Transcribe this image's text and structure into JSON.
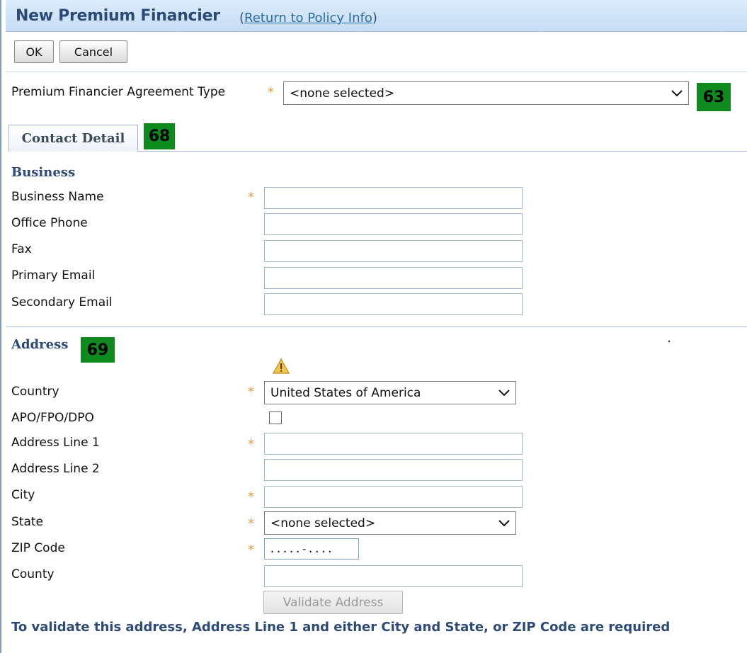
{
  "header": {
    "title": "New Premium Financier",
    "paren_open": "(",
    "link_text": "Return to Policy Info",
    "paren_close": ")"
  },
  "toolbar": {
    "ok_label": "OK",
    "cancel_label": "Cancel"
  },
  "agreement": {
    "label": "Premium Financier Agreement Type",
    "value": "<none selected>",
    "badge": "63"
  },
  "tab": {
    "label": "Contact Detail",
    "badge": "68"
  },
  "business": {
    "heading": "Business",
    "fields": [
      {
        "label": "Business Name",
        "required": true,
        "value": ""
      },
      {
        "label": "Office Phone",
        "required": false,
        "value": ""
      },
      {
        "label": "Fax",
        "required": false,
        "value": ""
      },
      {
        "label": "Primary Email",
        "required": false,
        "value": ""
      },
      {
        "label": "Secondary Email",
        "required": false,
        "value": ""
      }
    ]
  },
  "address": {
    "heading": "Address",
    "badge": "69",
    "country_label": "Country",
    "country_value": "United States of America",
    "apo_label": "APO/FPO/DPO",
    "line1_label": "Address Line 1",
    "line2_label": "Address Line 2",
    "city_label": "City",
    "state_label": "State",
    "state_value": "<none selected>",
    "zip_label": "ZIP Code",
    "zip_value": ".....-....",
    "county_label": "County",
    "validate_label": "Validate Address",
    "message": "To validate this address, Address Line 1 and either City and State, or ZIP Code are required"
  },
  "required_mark": "*",
  "colors": {
    "accent": "#2b4a78",
    "required": "#e39a3b",
    "badge": "#0f8a1f",
    "warning": "#f2c94c"
  },
  "icons": {
    "warning": "warning-icon",
    "dropdown": "chevron-down-icon"
  }
}
